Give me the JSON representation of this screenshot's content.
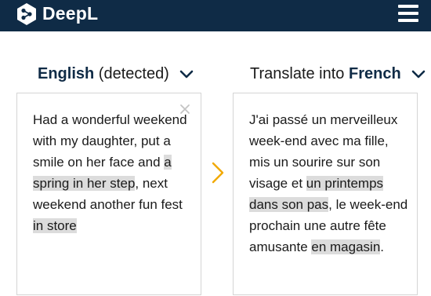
{
  "header": {
    "brand": "DeepL",
    "logo_icon": "deepl-logo",
    "menu_icon": "hamburger-menu-icon"
  },
  "source": {
    "language": "English",
    "note": "(detected)",
    "text_parts": [
      "Had a wonderful weekend with my daughter, put a smile on her face and ",
      "a spring in her step",
      ", next weekend another fun fest ",
      "in store"
    ]
  },
  "target": {
    "prefix": "Translate into ",
    "language": "French",
    "text_parts": [
      "J'ai passé un merveilleux week-end avec ma fille, mis un sourire sur son visage et ",
      "un printemps dans son pas",
      ", le week-end prochain une autre fête amusante ",
      "en magasin",
      "."
    ]
  },
  "colors": {
    "navy": "#0f2b46",
    "accent": "#f2a900",
    "highlight": "#dcdcdc",
    "border": "#d5d5d5"
  }
}
